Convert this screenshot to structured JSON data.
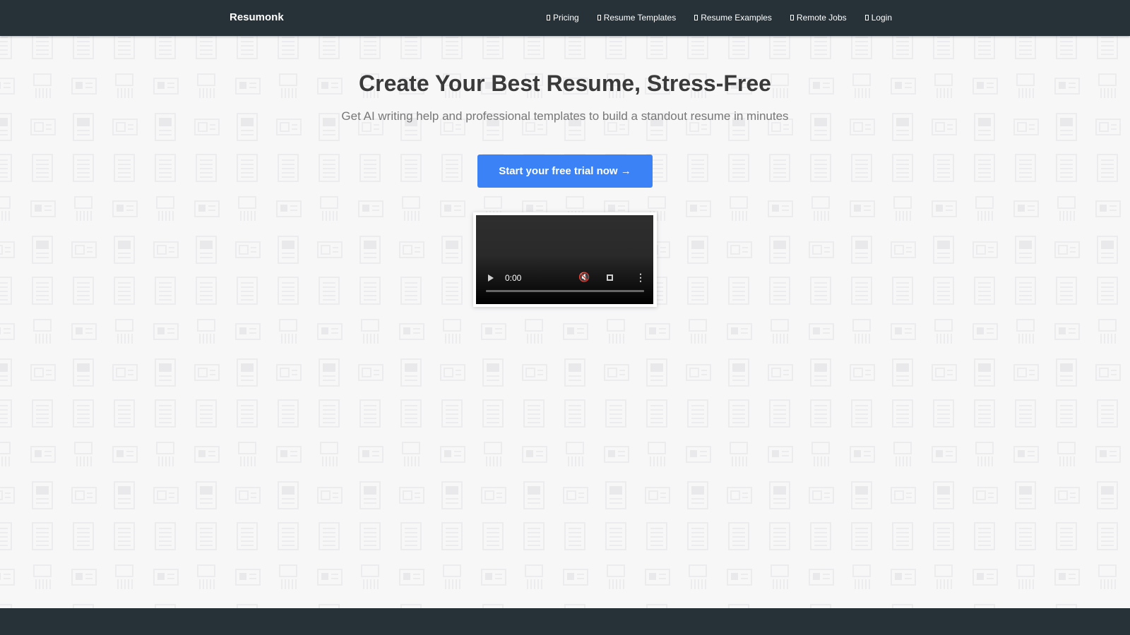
{
  "header": {
    "brand": "Resumonk",
    "nav": [
      {
        "label": "Pricing"
      },
      {
        "label": "Resume Templates"
      },
      {
        "label": "Resume Examples"
      },
      {
        "label": "Remote Jobs"
      },
      {
        "label": "Login"
      }
    ]
  },
  "hero": {
    "title": "Create Your Best Resume, Stress-Free",
    "subtitle": "Get AI writing help and professional templates to build a standout resume in minutes",
    "cta_label": "Start your free trial now →"
  },
  "video": {
    "time": "0:00",
    "progress": 0
  },
  "colors": {
    "header_bg": "#263238",
    "cta_bg": "#3b82f6",
    "page_bg": "#f7f7f8",
    "footer_bg": "#263238"
  },
  "icons": {
    "nav_glyph": "missing-glyph-icon",
    "video_play": "play-icon",
    "video_mute": "muted-volume-icon",
    "video_fullscreen": "fullscreen-icon",
    "video_more": "more-vertical-icon"
  }
}
